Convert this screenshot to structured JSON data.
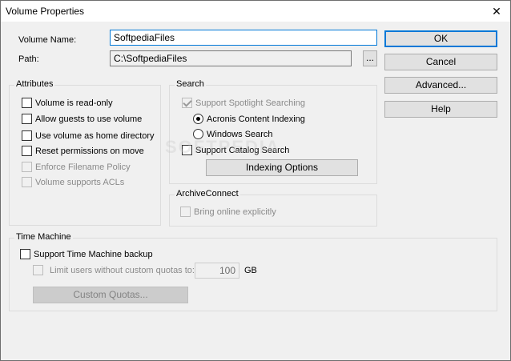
{
  "window": {
    "title": "Volume Properties",
    "close_glyph": "✕"
  },
  "fields": {
    "volume_name_label": "Volume Name:",
    "volume_name_value": "SoftpediaFiles",
    "path_label": "Path:",
    "path_value": "C:\\SoftpediaFiles",
    "browse_label": "..."
  },
  "buttons": {
    "ok": "OK",
    "cancel": "Cancel",
    "advanced": "Advanced...",
    "help": "Help"
  },
  "attributes": {
    "title": "Attributes",
    "items": [
      {
        "label": "Volume is read-only",
        "checked": false,
        "enabled": true
      },
      {
        "label": "Allow guests to use volume",
        "checked": false,
        "enabled": true
      },
      {
        "label": "Use volume as home directory",
        "checked": false,
        "enabled": true
      },
      {
        "label": "Reset permissions on move",
        "checked": false,
        "enabled": true
      },
      {
        "label": "Enforce Filename Policy",
        "checked": false,
        "enabled": false
      },
      {
        "label": "Volume supports ACLs",
        "checked": false,
        "enabled": false
      }
    ]
  },
  "search": {
    "title": "Search",
    "spotlight_label": "Support Spotlight Searching",
    "acronis_label": "Acronis Content Indexing",
    "windows_label": "Windows Search",
    "catalog_label": "Support Catalog Search",
    "indexing_button": "Indexing Options"
  },
  "archive": {
    "title": "ArchiveConnect",
    "bring_online_label": "Bring online explicitly"
  },
  "time_machine": {
    "title": "Time Machine",
    "support_label": "Support Time Machine backup",
    "limit_label": "Limit users without custom quotas to:",
    "limit_value": "100",
    "unit": "GB",
    "custom_quotas_button": "Custom Quotas..."
  },
  "watermark": "SOFTPEDIA"
}
